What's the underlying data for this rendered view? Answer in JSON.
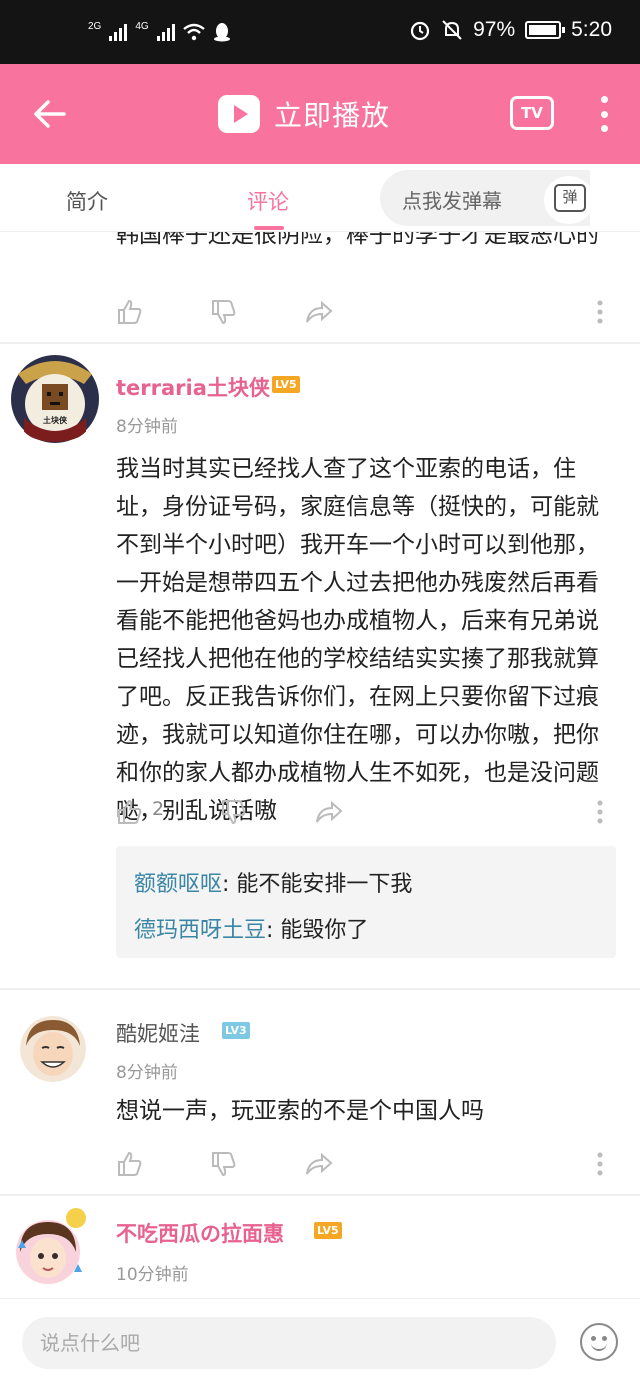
{
  "status_bar": {
    "network_1": "2G",
    "network_2": "4G",
    "battery": "97%",
    "battery_level": 0.97,
    "time": "5:20"
  },
  "header": {
    "back_icon": "arrow-left-icon",
    "title": "立即播放",
    "tv_label": "TV",
    "accent_color": "#f8739e"
  },
  "tabs": [
    {
      "label": "简介",
      "active": false
    },
    {
      "label": "评论",
      "active": true
    }
  ],
  "danmaku": {
    "placeholder": "点我发弹幕",
    "icon_label": "弹"
  },
  "comments": [
    {
      "id": "partial",
      "text": "韩国棒子还是很阴险，棒子的李子才是最恶心的",
      "likes": ""
    },
    {
      "id": "c1",
      "username": "terraria土块侠",
      "level": "LV5",
      "avatar_label": "土块侠",
      "time": "8分钟前",
      "text": "我当时其实已经找人查了这个亚索的电话，住址，身份证号码，家庭信息等（挺快的，可能就不到半个小时吧）我开车一个小时可以到他那，一开始是想带四五个人过去把他办残废然后再看看能不能把他爸妈也办成植物人，后来有兄弟说已经找人把他在他的学校结结实实揍了那我就算了吧。反正我告诉你们，在网上只要你留下过痕迹，我就可以知道你住在哪，可以办你嗷，把你和你的家人都办成植物人生不如死，也是没问题哒，别乱说话嗷",
      "likes": "2",
      "replies": [
        {
          "user": "额额呕呕",
          "text": ": 能不能安排一下我"
        },
        {
          "user": "德玛西呀土豆",
          "text": ": 能毁你了"
        }
      ]
    },
    {
      "id": "c2",
      "username": "酷妮姬洼",
      "level": "LV3",
      "time": "8分钟前",
      "text": "想说一声，玩亚索的不是个中国人吗",
      "likes": ""
    },
    {
      "id": "c3",
      "username": "不吃西瓜の拉面惠",
      "level": "LV5",
      "time": "10分钟前"
    }
  ],
  "bottom_bar": {
    "input_placeholder": "说点什么吧",
    "emoji_icon": "smile-icon"
  },
  "colors": {
    "accent": "#f8739e",
    "username_pink": "#e8628f",
    "reply_user": "#3b86a6",
    "level5": "#f5a623",
    "level3": "#7ec8e3"
  }
}
